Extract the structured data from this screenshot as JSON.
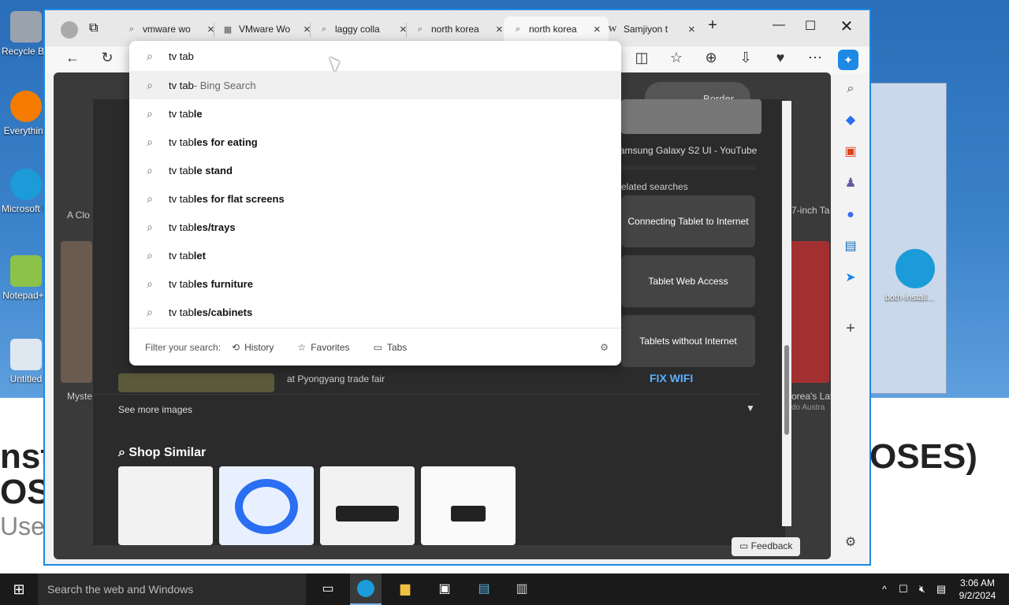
{
  "desktop": {
    "icons": [
      {
        "label": "Recycle Bin",
        "color": "#9aa3ad"
      },
      {
        "label": "Everything",
        "color": "#f57c00"
      },
      {
        "label": "Microsoft Edge",
        "color": "#1b9bd8"
      },
      {
        "label": "Notepad++",
        "color": "#8bc34a"
      },
      {
        "label": "Untitled",
        "color": "#dfe7f0"
      }
    ],
    "bg_text_left_1": "nst",
    "bg_text_left_2": "OS",
    "bg_text_left_3": "Use",
    "bg_text_right": "OSES)",
    "right_icon_label": "both-install..."
  },
  "browser": {
    "tabs": [
      {
        "title": "vmware wo",
        "icon": "search-icon",
        "active": false
      },
      {
        "title": "VMware Wo",
        "icon": "vmware-icon",
        "active": false
      },
      {
        "title": "laggy colla",
        "icon": "search-icon",
        "active": false
      },
      {
        "title": "north korea",
        "icon": "search-icon",
        "active": false
      },
      {
        "title": "north korea",
        "icon": "search-icon",
        "active": true
      },
      {
        "title": "Samjiyon t",
        "icon": "wikipedia-icon",
        "active": false
      }
    ],
    "address_query": "tv tab",
    "suggestions": [
      {
        "prefix": "tv tab",
        "suffix": "",
        "extra": " - Bing Search",
        "highlight": true
      },
      {
        "prefix": "tv tab",
        "suffix": "le",
        "extra": ""
      },
      {
        "prefix": "tv tab",
        "suffix": "les for eating",
        "extra": ""
      },
      {
        "prefix": "tv tab",
        "suffix": "le stand",
        "extra": ""
      },
      {
        "prefix": "tv tab",
        "suffix": "les for flat screens",
        "extra": ""
      },
      {
        "prefix": "tv tab",
        "suffix": "les/trays",
        "extra": ""
      },
      {
        "prefix": "tv tab",
        "suffix": "let",
        "extra": ""
      },
      {
        "prefix": "tv tab",
        "suffix": "les furniture",
        "extra": ""
      },
      {
        "prefix": "tv tab",
        "suffix": "les/cabinets",
        "extra": ""
      }
    ],
    "filter": {
      "label": "Filter your search:",
      "history": "History",
      "favorites": "Favorites",
      "tabs": "Tabs"
    },
    "page": {
      "filter_chip": "Border",
      "video_caption": "amsung Galaxy S2 UI - YouTube",
      "related_label": "elated searches",
      "related": [
        "Connecting Tablet to Internet",
        "Tablet Web Access",
        "Tablets without Internet"
      ],
      "fix_wifi": "FIX WIFI",
      "left_caption_1": "A Clo",
      "left_caption_2": "Myste",
      "trade_fair_caption": "at Pyongyang trade fair",
      "right_caption_1": "7-inch Ta",
      "right_caption_2": "orea's Lat",
      "right_caption_3": "do Austra",
      "see_more": "See more images",
      "shop_similar": "Shop Similar",
      "feedback": "Feedback"
    }
  },
  "taskbar": {
    "search_placeholder": "Search the web and Windows",
    "time": "3:06 AM",
    "date": "9/2/2024"
  }
}
